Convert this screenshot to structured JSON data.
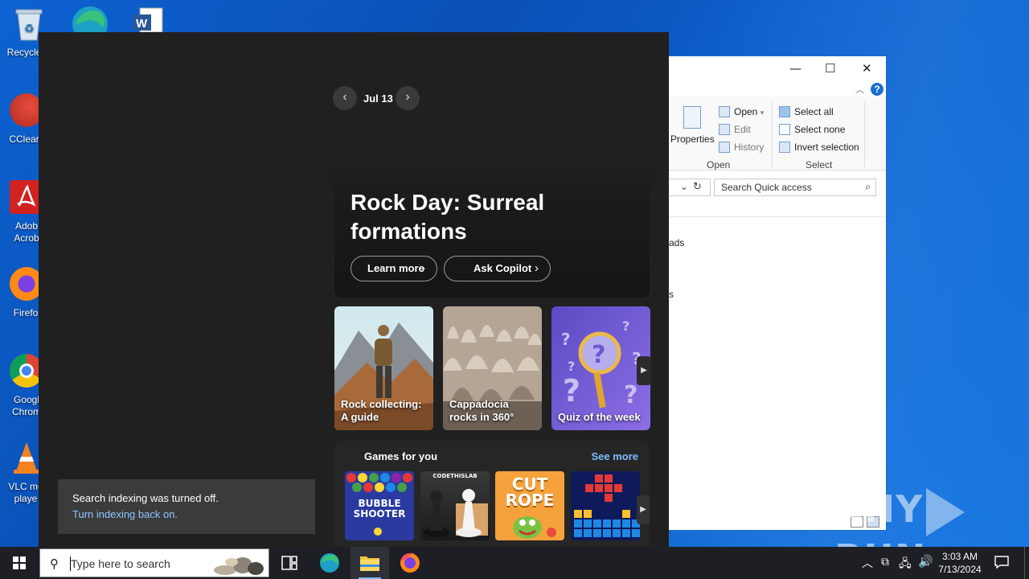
{
  "desktop": {
    "icons": [
      {
        "label": "Recycle"
      },
      {
        "label": "CClear"
      },
      {
        "label": "Adob\nAcrob"
      },
      {
        "label": "Firefo"
      },
      {
        "label": "Googl\nChrom"
      },
      {
        "label": "VLC me\nplaye"
      }
    ]
  },
  "explorer": {
    "ribbon": {
      "properties": "Properties",
      "open": "Open",
      "edit": "Edit",
      "history": "History",
      "select_all": "Select all",
      "select_none": "Select none",
      "invert_selection": "Invert selection",
      "group_open": "Open",
      "group_select": "Select"
    },
    "search_placeholder": "Search Quick access",
    "list_fragment_1": "ads",
    "list_fragment_2": "s"
  },
  "widgets": {
    "date": "Jul 13",
    "hero": {
      "title": "Rock Day: Surreal formations",
      "learn_more": "Learn more",
      "ask_copilot": "Ask Copilot"
    },
    "cards": [
      {
        "caption": "Rock collecting: A guide"
      },
      {
        "caption": "Cappadocia rocks in 360°"
      },
      {
        "caption": "Quiz of the week"
      }
    ],
    "games": {
      "title": "Games for you",
      "see_more": "See more",
      "tiles": [
        {
          "art_text": "BUBBLE SHOOTER"
        },
        {
          "art_text": "CODETHISLAB"
        },
        {
          "art_text": "CUT ROPE"
        },
        {
          "art_text": ""
        }
      ]
    }
  },
  "toast": {
    "line1": "Search indexing was turned off.",
    "line2": "Turn indexing back on."
  },
  "taskbar": {
    "search_placeholder": "Type here to search",
    "time": "3:03 AM",
    "date": "7/13/2024"
  },
  "watermark": {
    "text_left": "ANY",
    "text_right": "RUN"
  },
  "colors": {
    "panel_bg": "#202020",
    "accent_link": "#7bbcff",
    "taskbar_bg": "#1d1f24",
    "desktop_blue": "#0a5bc4"
  }
}
